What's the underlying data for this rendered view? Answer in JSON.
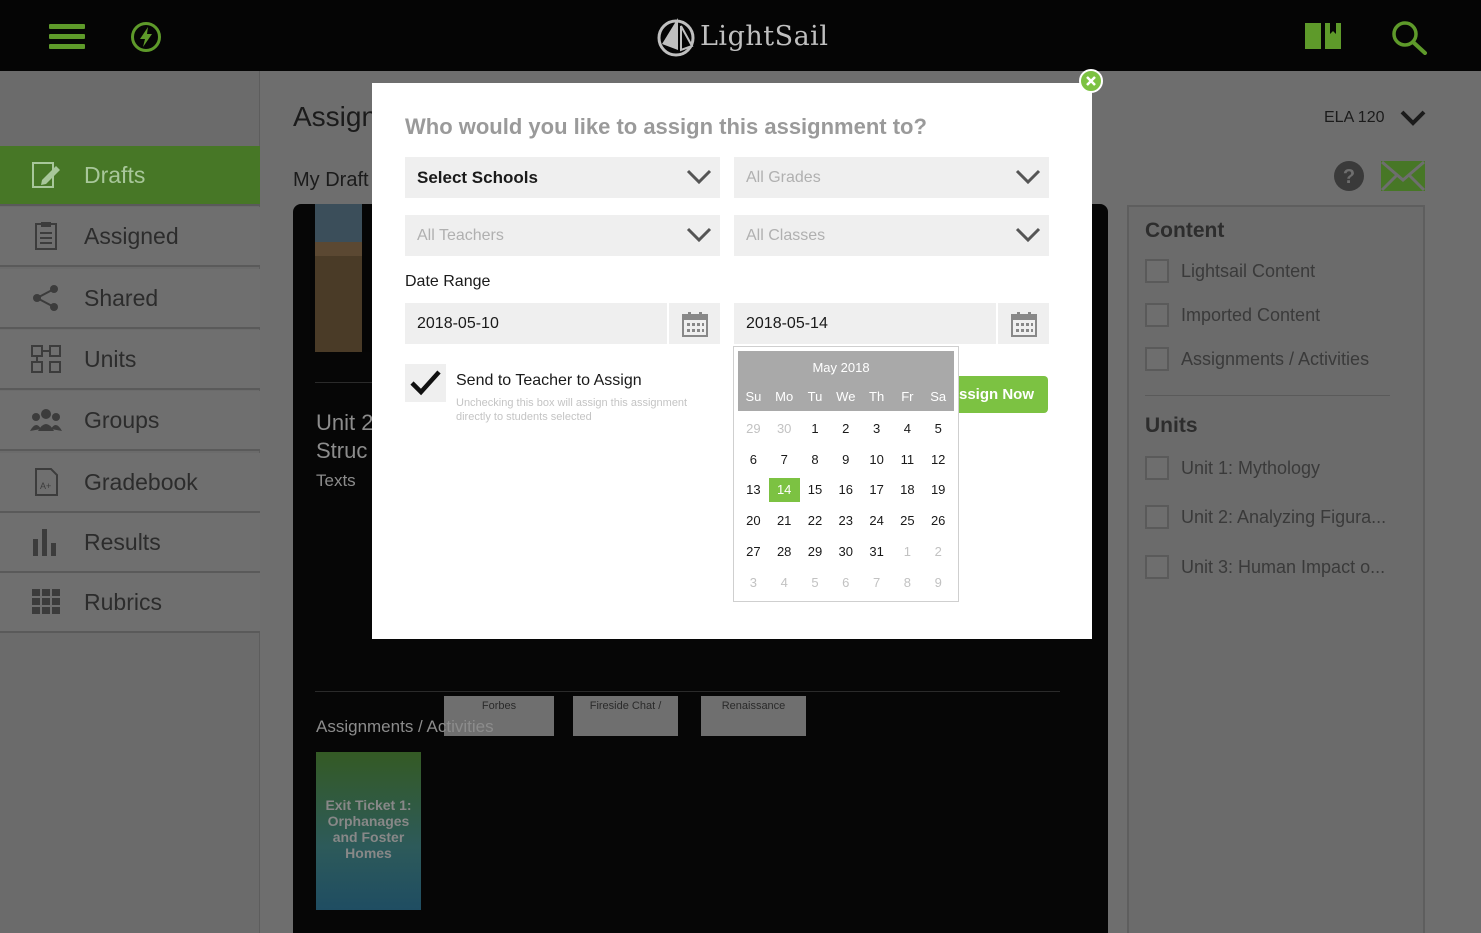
{
  "app": {
    "name": "LightSail"
  },
  "colors": {
    "accent": "#7cc242",
    "topbar": "#050505",
    "sidebar_active": "#477726"
  },
  "topbar": {
    "icons": [
      "menu-icon",
      "lightning-icon",
      "book-icon",
      "search-icon"
    ]
  },
  "sidebar": {
    "items": [
      {
        "label": "Drafts",
        "icon": "pencil-note-icon",
        "active": true
      },
      {
        "label": "Assigned",
        "icon": "clipboard-icon",
        "active": false
      },
      {
        "label": "Shared",
        "icon": "share-icon",
        "active": false
      },
      {
        "label": "Units",
        "icon": "units-icon",
        "active": false
      },
      {
        "label": "Groups",
        "icon": "groups-icon",
        "active": false
      },
      {
        "label": "Gradebook",
        "icon": "gradebook-icon",
        "active": false
      },
      {
        "label": "Results",
        "icon": "bar-chart-icon",
        "active": false
      },
      {
        "label": "Rubrics",
        "icon": "grid-icon",
        "active": false
      }
    ]
  },
  "main": {
    "title": "Assign",
    "subtitle": "My Draft",
    "course": "ELA 120",
    "unit_title_1": "Unit 2",
    "unit_title_2": "Struc",
    "texts_label": "Texts",
    "text_cards": [
      "Forbes",
      "Fireside Chat /",
      "Renaissance"
    ],
    "assignments_label": "Assignments / Activities",
    "ticket": "Exit Ticket 1: Orphanages and Foster Homes"
  },
  "filters": {
    "content_heading": "Content",
    "content_items": [
      "Lightsail Content",
      "Imported Content",
      "Assignments / Activities"
    ],
    "units_heading": "Units",
    "unit_items": [
      "Unit 1: Mythology",
      "Unit 2: Analyzing Figura...",
      "Unit 3: Human Impact o..."
    ]
  },
  "modal": {
    "question": "Who would you like to assign this assignment to?",
    "schools": "Select Schools",
    "grades_placeholder": "All Grades",
    "teachers_placeholder": "All Teachers",
    "classes_placeholder": "All Classes",
    "date_range_label": "Date Range",
    "start_date": "2018-05-10",
    "end_date": "2018-05-14",
    "send_label": "Send to Teacher to Assign",
    "send_help": "Unchecking this box will assign this assignment directly to students selected",
    "send_checked": true,
    "assign_button": "ssign Now"
  },
  "calendar": {
    "month": "May 2018",
    "dows": [
      "Su",
      "Mo",
      "Tu",
      "We",
      "Th",
      "Fr",
      "Sa"
    ],
    "selected": "14",
    "weeks": [
      [
        "29",
        "30",
        "1",
        "2",
        "3",
        "4",
        "5"
      ],
      [
        "6",
        "7",
        "8",
        "9",
        "10",
        "11",
        "12"
      ],
      [
        "13",
        "14",
        "15",
        "16",
        "17",
        "18",
        "19"
      ],
      [
        "20",
        "21",
        "22",
        "23",
        "24",
        "25",
        "26"
      ],
      [
        "27",
        "28",
        "29",
        "30",
        "31",
        "1",
        "2"
      ],
      [
        "3",
        "4",
        "5",
        "6",
        "7",
        "8",
        "9"
      ]
    ],
    "muted": [
      [
        0,
        0
      ],
      [
        0,
        1
      ],
      [
        4,
        5
      ],
      [
        4,
        6
      ],
      [
        5,
        0
      ],
      [
        5,
        1
      ],
      [
        5,
        2
      ],
      [
        5,
        3
      ],
      [
        5,
        4
      ],
      [
        5,
        5
      ],
      [
        5,
        6
      ]
    ]
  }
}
